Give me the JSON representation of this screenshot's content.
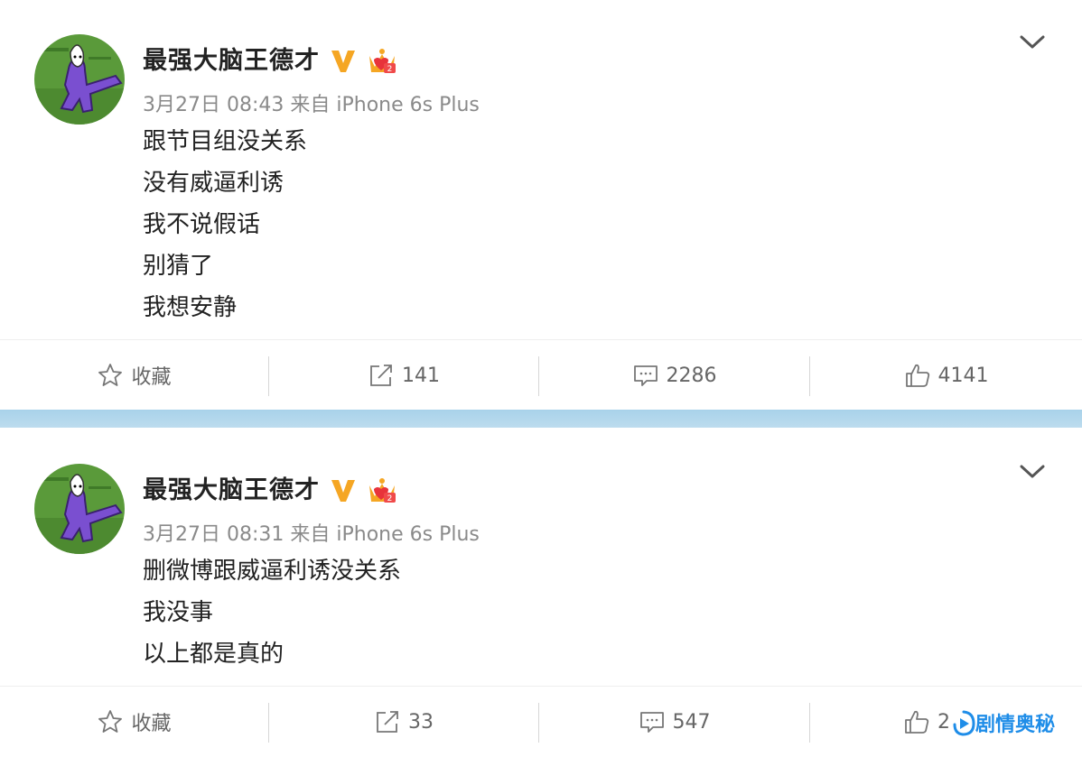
{
  "posts": [
    {
      "username": "最强大脑王德才",
      "verified_badge": "V",
      "timestamp": "3月27日 08:43",
      "source": "来自 iPhone 6s Plus",
      "lines": [
        "跟节目组没关系",
        "没有威逼利诱",
        "我不说假话",
        "别猜了",
        "我想安静"
      ],
      "actions": {
        "favorite_label": "收藏",
        "repost_count": "141",
        "comment_count": "2286",
        "like_count": "4141"
      }
    },
    {
      "username": "最强大脑王德才",
      "verified_badge": "V",
      "timestamp": "3月27日 08:31",
      "source": "来自 iPhone 6s Plus",
      "lines": [
        "删微博跟威逼利诱没关系",
        "我没事",
        "以上都是真的"
      ],
      "actions": {
        "favorite_label": "收藏",
        "repost_count": "33",
        "comment_count": "547",
        "like_count": "2"
      }
    }
  ],
  "watermark": "剧情奥秘",
  "colors": {
    "badge_gold": "#f5a623",
    "separator": "#b3d8ec",
    "watermark": "#1f8de8",
    "avatar_bg": "#5a9a3a"
  },
  "icons": [
    "chevron-down-icon",
    "star-icon",
    "repost-icon",
    "comment-icon",
    "thumbs-up-icon",
    "verified-v-icon",
    "crown-icon"
  ]
}
